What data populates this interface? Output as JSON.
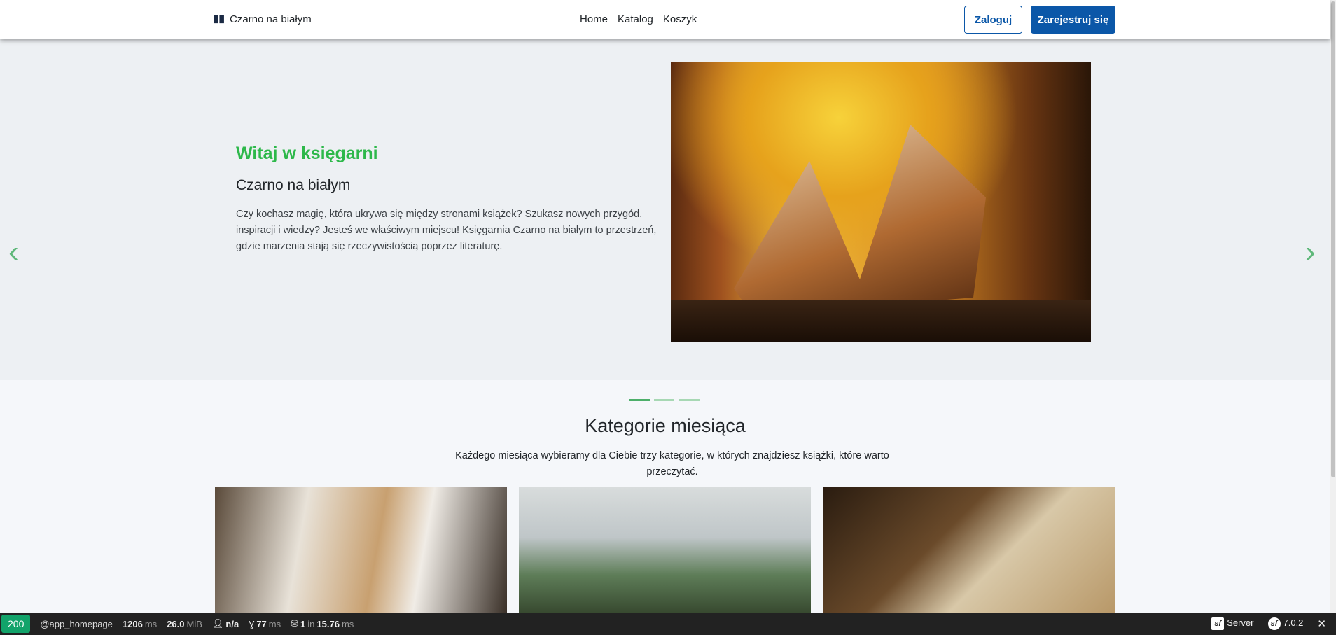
{
  "nav": {
    "brand": "Czarno na białym",
    "links": [
      "Home",
      "Katalog",
      "Koszyk"
    ],
    "login": "Zaloguj",
    "register": "Zarejestruj się"
  },
  "hero": {
    "title": "Witaj w księgarni",
    "subtitle": "Czarno na białym",
    "text": "Czy kochasz magię, która ukrywa się między stronami książek? Szukasz nowych przygód, inspiracji i wiedzy? Jesteś we właściwym miejscu! Księgarnia Czarno na białym to przestrzeń, gdzie marzenia stają się rzeczywistością poprzez literaturę.",
    "slides": 3,
    "active_slide": 1,
    "accent": "#2db84a"
  },
  "categories": {
    "title": "Kategorie miesiąca",
    "text": "Każdego miesiąca wybieramy dla Ciebie trzy kategorie, w których znajdziesz książki, które warto przeczytać."
  },
  "toolbar": {
    "status": "200",
    "route": "@app_homepage",
    "time": "1206",
    "time_unit": "ms",
    "memory": "26.0",
    "memory_unit": "MiB",
    "user": "n/a",
    "init": "77",
    "init_unit": "ms",
    "db_count": "1",
    "db_in": "in",
    "db_time": "15.76",
    "db_unit": "ms",
    "server": "Server",
    "version": "7.0.2",
    "close": "✕",
    "status_color": "#12a36a"
  }
}
